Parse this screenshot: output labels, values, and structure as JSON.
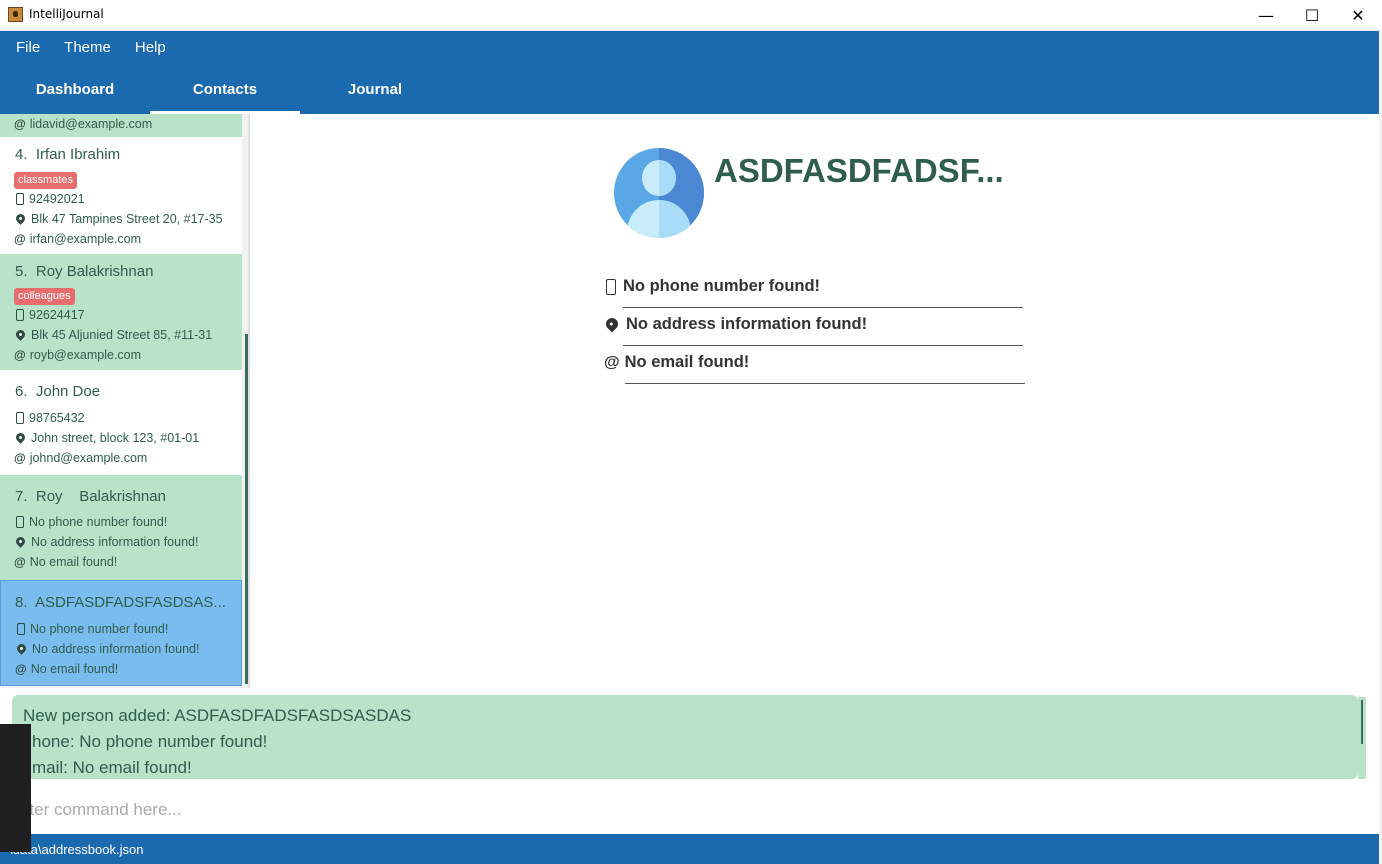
{
  "window": {
    "title": "IntelliJournal",
    "minimize": "—",
    "maximize": "☐",
    "close": "✕"
  },
  "menu": [
    "File",
    "Theme",
    "Help"
  ],
  "tabs": [
    {
      "label": "Dashboard",
      "active": false
    },
    {
      "label": "Contacts",
      "active": true
    },
    {
      "label": "Journal",
      "active": false
    }
  ],
  "contacts": {
    "partial": {
      "email": "lidavid@example.com"
    },
    "items": [
      {
        "index": "4.",
        "name": "Irfan Ibrahim",
        "tag": "classmates",
        "phone": "92492021",
        "address": "Blk 47 Tampines Street 20, #17-35",
        "email": "irfan@example.com"
      },
      {
        "index": "5.",
        "name": "Roy Balakrishnan",
        "tag": "colleagues",
        "phone": "92624417",
        "address": "Blk 45 Aljunied Street 85, #11-31",
        "email": "royb@example.com"
      },
      {
        "index": "6.",
        "name": "John Doe",
        "phone": "98765432",
        "address": "John street, block 123, #01-01",
        "email": "johnd@example.com"
      },
      {
        "index": "7.",
        "name": "Roy    Balakrishnan",
        "phone": "No phone number found!",
        "address": "No address information found!",
        "email": "No email found!"
      },
      {
        "index": "8.",
        "name": "ASDFASDFADSFASDSAS...",
        "phone": "No phone number found!",
        "address": "No address information found!",
        "email": "No email found!"
      }
    ]
  },
  "detail": {
    "name": "ASDFASDFADSF...",
    "phone": "No phone number found!",
    "address": "No address information found!",
    "email": "No email found!"
  },
  "result": {
    "line1": "New person added: ASDFASDFADSFASDSASDAS",
    "line2": "hone: No phone number found!",
    "line3": "mail: No email found!"
  },
  "command": {
    "placeholder": "nter command here..."
  },
  "status": {
    "path": "\\data\\addressbook.json"
  },
  "colors": {
    "header": "#1b69ae",
    "card_green": "#b8e3c9",
    "card_selected": "#7bbcee",
    "tag": "#e86d6d"
  }
}
